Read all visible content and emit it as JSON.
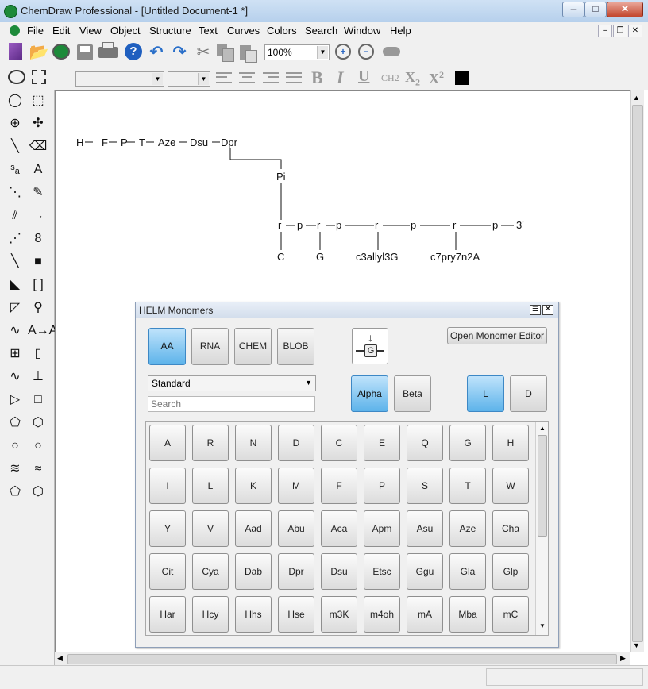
{
  "window": {
    "title": "ChemDraw Professional - [Untitled Document-1 *]",
    "controls": {
      "minimize": "–",
      "maximize": "□",
      "close": "✕"
    }
  },
  "menus": [
    "File",
    "Edit",
    "View",
    "Object",
    "Structure",
    "Text",
    "Curves",
    "Colors",
    "Search",
    "Window",
    "Help"
  ],
  "toolbar": {
    "zoom": "100%",
    "icons": [
      "new-doc",
      "open",
      "open-online",
      "save",
      "print",
      "help",
      "undo",
      "redo",
      "cut",
      "copy",
      "paste",
      "zoom-in",
      "zoom-out",
      "cloud"
    ]
  },
  "format_bar": {
    "font": "",
    "size": "",
    "subscript_label": "CH2",
    "x_sub": "X",
    "x_sub_digit": "2",
    "x_sup": "X",
    "x_sup_digit": "2"
  },
  "palette": [
    [
      "lasso",
      "marquee"
    ],
    [
      "chain",
      "bond-sculpt"
    ],
    [
      "line",
      "eraser"
    ],
    [
      "atom-map",
      "A"
    ],
    [
      "dashed-bond",
      "pen"
    ],
    [
      "hashed-bond",
      "arrow"
    ],
    [
      "hashed-wedge",
      "orbital"
    ],
    [
      "bold-bond",
      "filled-rect"
    ],
    [
      "wedge-bond",
      "brackets"
    ],
    [
      "hollow-wedge",
      "query"
    ],
    [
      "wavy-bond",
      "A→A"
    ],
    [
      "table",
      "tlc"
    ],
    [
      "hydrogen-bond",
      "stamp"
    ],
    [
      "triangle",
      "square"
    ],
    [
      "pentagon",
      "hexagon"
    ],
    [
      "heptagon",
      "octagon"
    ],
    [
      "chair1",
      "chair2"
    ],
    [
      "cyclopentadiene",
      "benzene"
    ]
  ],
  "structure": {
    "peptide_chain": [
      "H",
      "F",
      "P",
      "T",
      "Aze",
      "Dsu",
      "Dpr"
    ],
    "linker": "Pi",
    "rna_backbone": [
      "r",
      "p",
      "r",
      "p",
      "r",
      "p",
      "r",
      "p",
      "3'"
    ],
    "bases": [
      "C",
      "G",
      "c3allyl3G",
      "c7pry7n2A"
    ]
  },
  "dialog": {
    "title": "HELM Monomers",
    "type_tabs": [
      "AA",
      "RNA",
      "CHEM",
      "BLOB"
    ],
    "active_tab": "AA",
    "open_editor": "Open Monomer Editor",
    "monomer_icon_label": "G",
    "library": "Standard",
    "search_placeholder": "Search",
    "alpha_beta": [
      "Alpha",
      "Beta"
    ],
    "l_d": [
      "L",
      "D"
    ],
    "monomers": [
      [
        "A",
        "R",
        "N",
        "D",
        "C",
        "E",
        "Q",
        "G",
        "H"
      ],
      [
        "I",
        "L",
        "K",
        "M",
        "F",
        "P",
        "S",
        "T",
        "W"
      ],
      [
        "Y",
        "V",
        "Aad",
        "Abu",
        "Aca",
        "Apm",
        "Asu",
        "Aze",
        "Cha"
      ],
      [
        "Cit",
        "Cya",
        "Dab",
        "Dpr",
        "Dsu",
        "Etsc",
        "Ggu",
        "Gla",
        "Glp"
      ],
      [
        "Har",
        "Hcy",
        "Hhs",
        "Hse",
        "m3K",
        "m4oh",
        "mA",
        "Mba",
        "mC"
      ]
    ]
  },
  "colors": {
    "accent": "#5db3ea",
    "titlebar": "#c3d8ef",
    "chrome": "#f0f0f0"
  }
}
